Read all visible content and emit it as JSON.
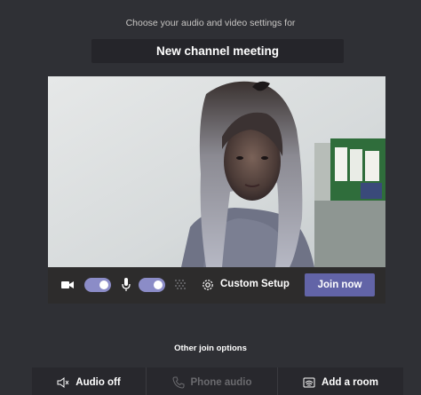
{
  "header": {
    "prompt": "Choose your audio and video settings for",
    "meeting_title": "New channel meeting"
  },
  "controls": {
    "camera_on": true,
    "mic_on": true,
    "custom_setup_label": "Custom Setup",
    "join_label": "Join now"
  },
  "other_options": {
    "label": "Other join options",
    "items": [
      {
        "label": "Audio off",
        "icon": "speaker-muted-icon",
        "enabled": true
      },
      {
        "label": "Phone audio",
        "icon": "phone-icon",
        "enabled": false
      },
      {
        "label": "Add a room",
        "icon": "cast-room-icon",
        "enabled": true
      }
    ]
  },
  "colors": {
    "background": "#2f3035",
    "accent": "#6264a7",
    "toggle_on": "#8b8cc7"
  }
}
